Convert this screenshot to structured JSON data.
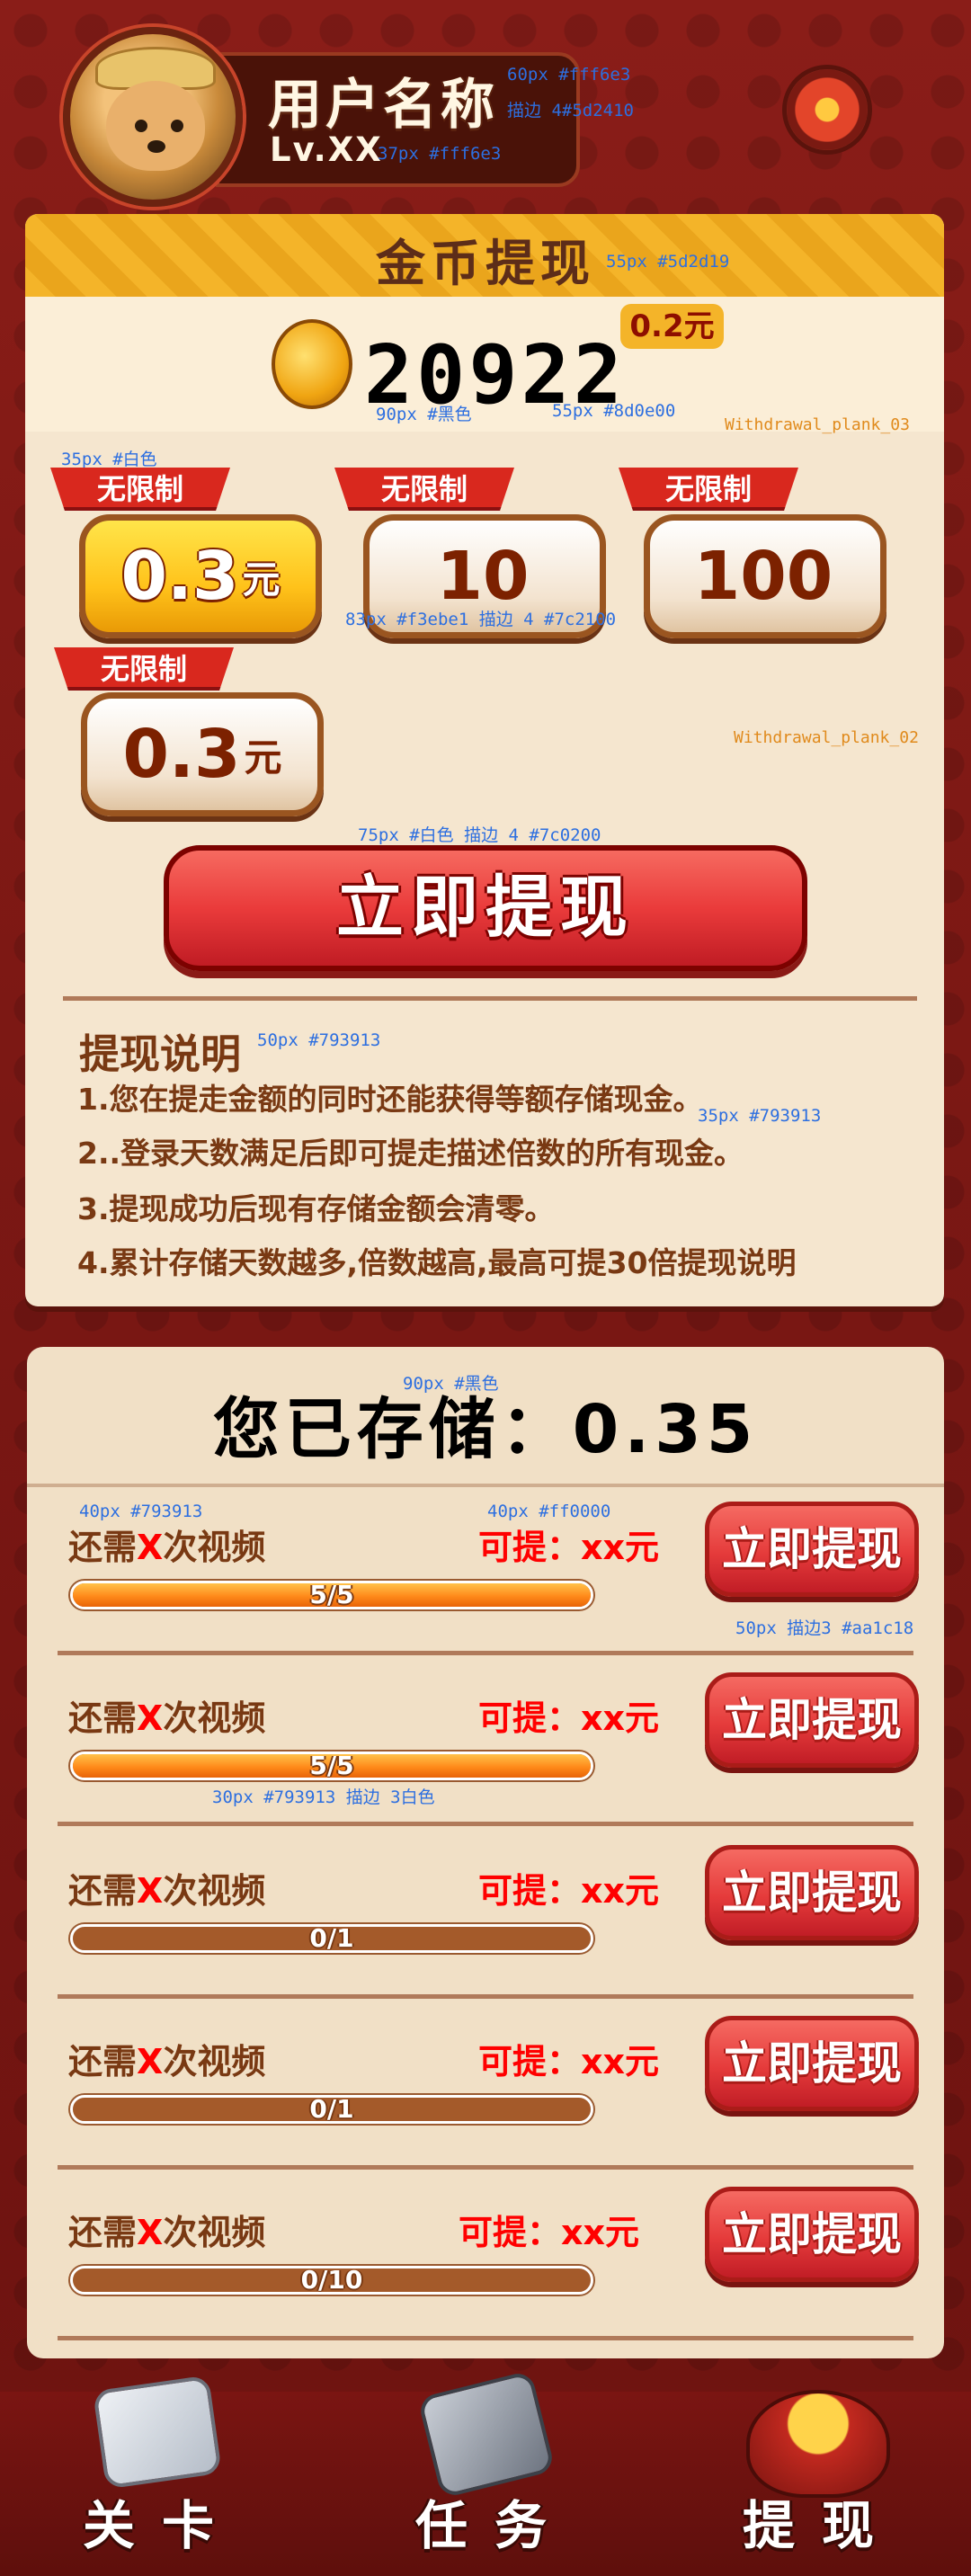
{
  "user": {
    "name": "用户名称",
    "level": "Lv.XX"
  },
  "panel": {
    "title": "金币提现",
    "coin_balance": "20922",
    "rmb_value": "0.2元"
  },
  "options": [
    {
      "tag": "无限制",
      "value": "0.3",
      "unit": "元",
      "selected": true
    },
    {
      "tag": "无限制",
      "value": "10",
      "unit": "",
      "selected": false
    },
    {
      "tag": "无限制",
      "value": "100",
      "unit": "",
      "selected": false
    },
    {
      "tag": "无限制",
      "value": "0.3",
      "unit": "元",
      "selected": false
    }
  ],
  "withdraw_button": "立即提现",
  "description": {
    "title": "提现说明",
    "lines": [
      "1.您在提走金额的同时还能获得等额存储现金。",
      "2..登录天数满足后即可提走描述倍数的所有现金。",
      "3.提现成功后现有存储金额会清零。",
      "4.累计存储天数越多,倍数越高,最高可提30倍提现说明"
    ]
  },
  "storage": {
    "title": "您已存储：0.35",
    "rows": [
      {
        "need_prefix": "还需",
        "need_x": "X",
        "need_suffix": "次视频",
        "can": "可提：xx元",
        "progress": "5/5",
        "fraction": 1.0,
        "button": "立即提现"
      },
      {
        "need_prefix": "还需",
        "need_x": "X",
        "need_suffix": "次视频",
        "can": "可提：xx元",
        "progress": "5/5",
        "fraction": 1.0,
        "button": "立即提现"
      },
      {
        "need_prefix": "还需",
        "need_x": "X",
        "need_suffix": "次视频",
        "can": "可提：xx元",
        "progress": "0/1",
        "fraction": 0.0,
        "button": "立即提现"
      },
      {
        "need_prefix": "还需",
        "need_x": "X",
        "need_suffix": "次视频",
        "can": "可提：xx元",
        "progress": "0/1",
        "fraction": 0.0,
        "button": "立即提现"
      },
      {
        "need_prefix": "还需",
        "need_x": "X",
        "need_suffix": "次视频",
        "can": "可提：xx元",
        "progress": "0/10",
        "fraction": 0.0,
        "button": "立即提现"
      }
    ]
  },
  "nav": [
    {
      "label": "关卡",
      "icon": "map-scroll-icon"
    },
    {
      "label": "任务",
      "icon": "task-book-icon"
    },
    {
      "label": "提现",
      "icon": "treasure-bag-icon"
    }
  ],
  "annotations": {
    "a1": "60px #fff6e3",
    "a2": "描边 4#5d2410",
    "a3": "37px #fff6e3",
    "a4": "55px #5d2d19",
    "a5": "90px #黑色",
    "a6": "55px #8d0e00",
    "a7": "Withdrawal_plank_03",
    "a8": "35px #白色",
    "a9": "83px #f3ebe1 描边 4 #7c2100",
    "a10": "Withdrawal_plank_02",
    "a11": "75px #白色 描边 4 #7c0200",
    "a12": "50px #793913",
    "a13": "35px #793913",
    "a14": "90px #黑色",
    "a15": "40px #793913",
    "a16": "40px #ff0000",
    "a17": "50px 描边3 #aa1c18",
    "a18": "30px #793913 描边 3白色"
  },
  "colors": {
    "accent_red": "#ea3b3b",
    "gold": "#f4b429",
    "text_brown": "#793913",
    "bg_dark_red": "#7a1512"
  }
}
